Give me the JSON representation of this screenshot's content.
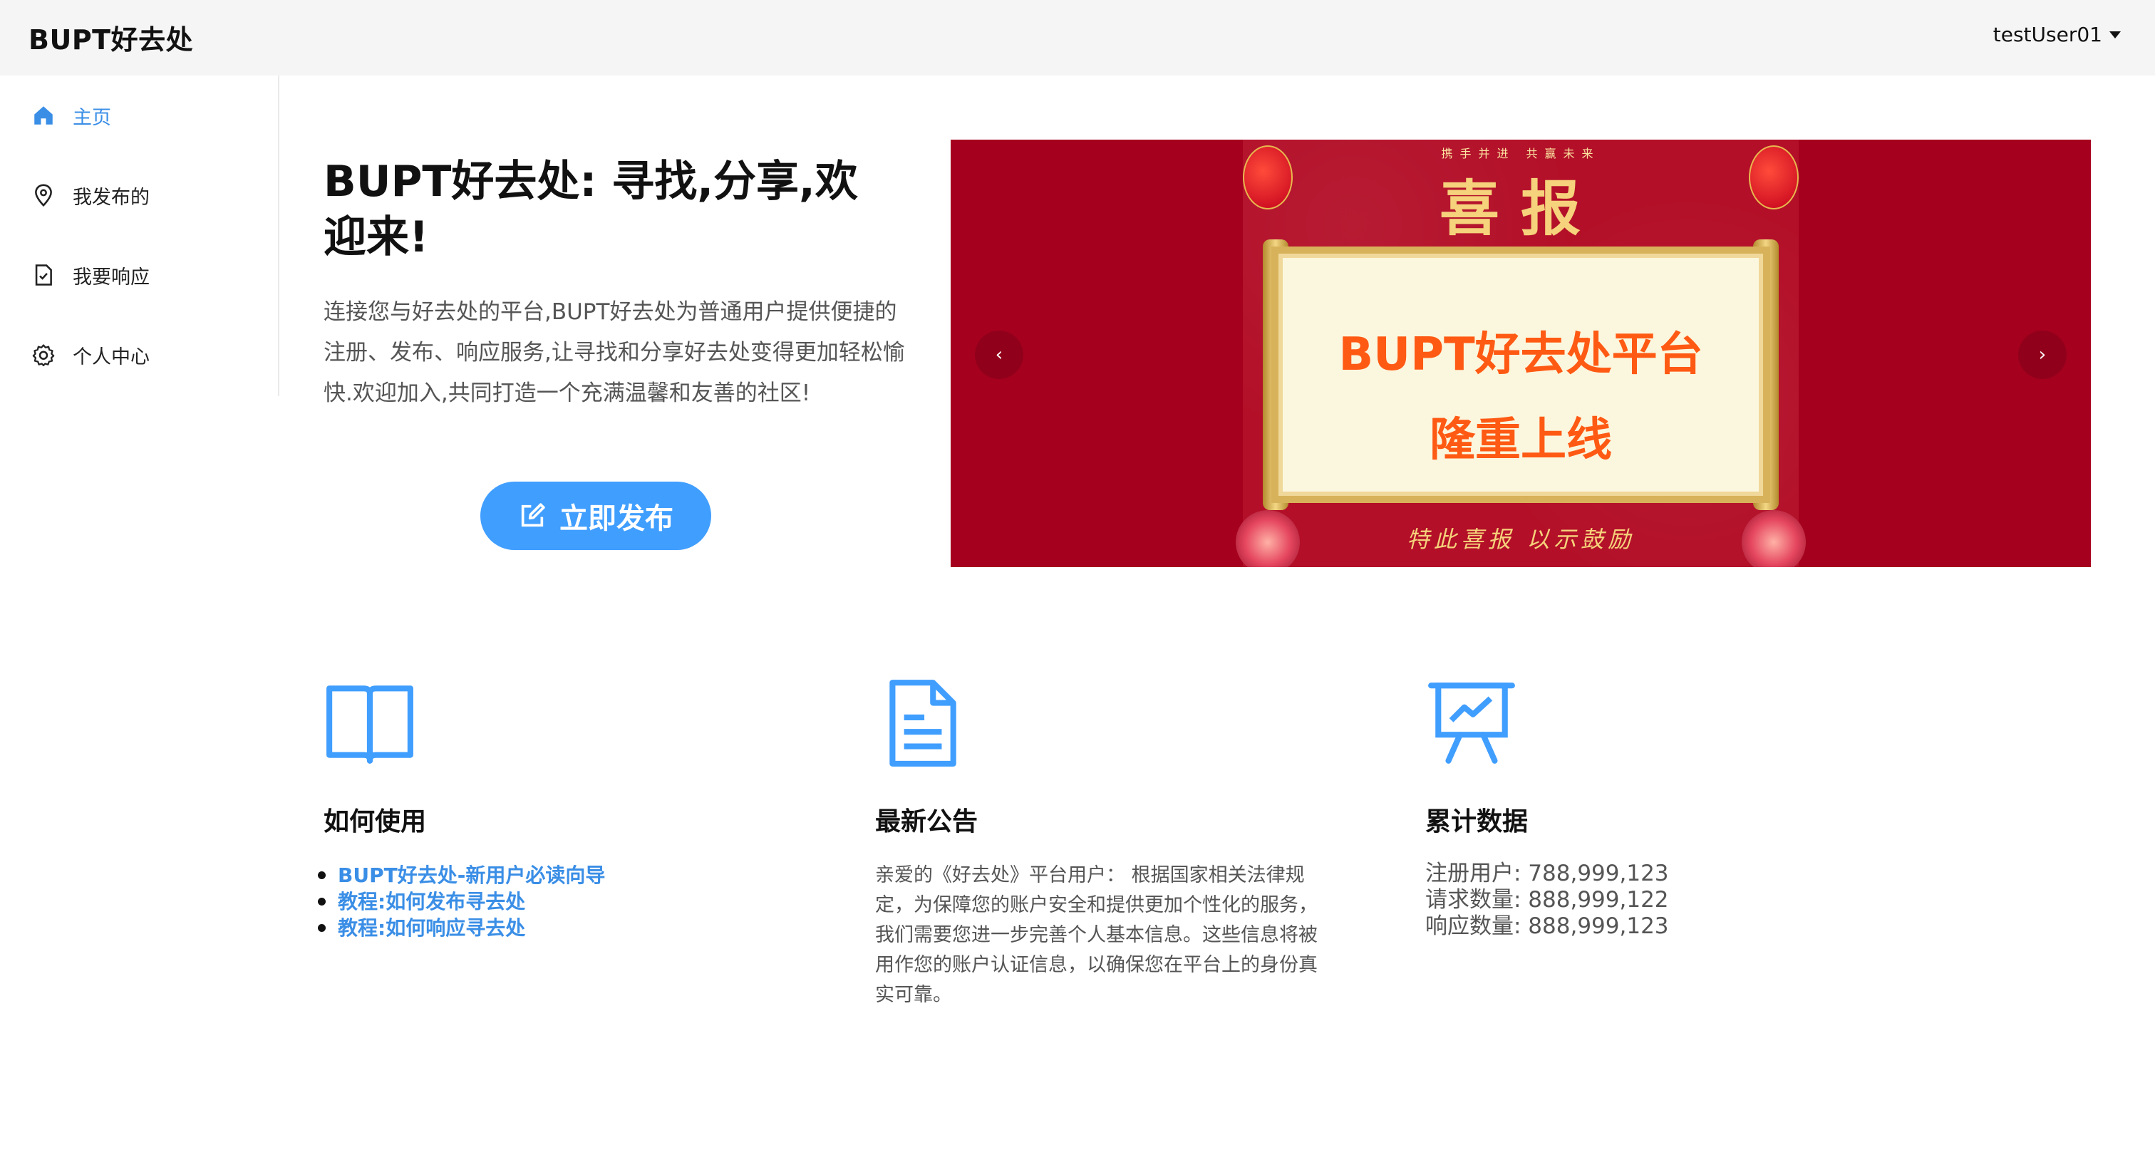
{
  "header": {
    "brand": "BUPT好去处",
    "user": "testUser01"
  },
  "sidebar": {
    "items": [
      {
        "label": "主页",
        "icon": "home-icon",
        "active": true
      },
      {
        "label": "我发布的",
        "icon": "location-pin-icon",
        "active": false
      },
      {
        "label": "我要响应",
        "icon": "document-check-icon",
        "active": false
      },
      {
        "label": "个人中心",
        "icon": "gear-icon",
        "active": false
      }
    ]
  },
  "hero": {
    "title": "BUPT好去处: 寻找,分享,欢迎来!",
    "description": "连接您与好去处的平台,BUPT好去处为普通用户提供便捷的注册、发布、响应服务,让寻找和分享好去处变得更加轻松愉快.欢迎加入,共同打造一个充满温馨和友善的社区!",
    "publish_button": "立即发布"
  },
  "carousel": {
    "prev": "‹",
    "next": "›",
    "slide": {
      "top_text": "携手并进 共赢未来",
      "heading": "喜报",
      "line1": "BUPT好去处平台",
      "line2": "隆重上线",
      "bottom_text": "特此喜报 以示鼓励"
    }
  },
  "features": {
    "usage": {
      "icon": "open-book-icon",
      "title": "如何使用",
      "links": [
        "BUPT好去处-新用户必读向导",
        "教程:如何发布寻去处",
        "教程:如何响应寻去处"
      ]
    },
    "notice": {
      "icon": "document-icon",
      "title": "最新公告",
      "text": "亲爱的《好去处》平台用户： 根据国家相关法律规定，为保障您的账户安全和提供更加个性化的服务，我们需要您进一步完善个人基本信息。这些信息将被用作您的账户认证信息，以确保您在平台上的身份真实可靠。"
    },
    "stats": {
      "icon": "presentation-chart-icon",
      "title": "累计数据",
      "lines": [
        "注册用户: 788,999,123",
        "请求数量: 888,999,122",
        "响应数量: 888,999,123"
      ]
    }
  },
  "colors": {
    "accent": "#409eff",
    "link": "#3a8ee6",
    "carousel_bg": "#a5001e"
  }
}
